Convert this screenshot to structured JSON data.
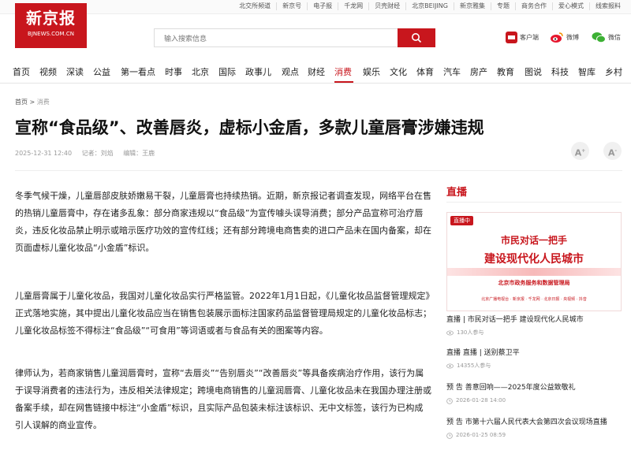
{
  "top_links": [
    "北交所频道",
    "新京号",
    "电子报",
    "千龙网",
    "贝壳财经",
    "北京BEIJING",
    "新京雅集",
    "专题",
    "商务合作",
    "爱心模式",
    "线索报料"
  ],
  "logo": {
    "cn": "新京报",
    "en": "BJNEWS.COM.CN"
  },
  "search": {
    "placeholder": "输入搜索信息"
  },
  "tools": {
    "client": "客户端",
    "weibo": "微博",
    "wechat": "微信"
  },
  "nav": [
    "首页",
    "视频",
    "深读",
    "公益",
    "第一看点",
    "时事",
    "北京",
    "国际",
    "政事儿",
    "观点",
    "财经",
    "消费",
    "娱乐",
    "文化",
    "体育",
    "汽车",
    "房产",
    "教育",
    "图说",
    "科技",
    "智库",
    "乡村"
  ],
  "nav_active": "消费",
  "breadcrumb": {
    "home": "首页",
    "sep": ">",
    "current": "消费"
  },
  "article": {
    "title": "宣称“食品级”、改善唇炎，虚标小金盾，多款儿童唇膏涉嫌违规",
    "date": "2025-12-31 12:40",
    "reporter": "记者：刘焰",
    "editor": "编辑：王鹿",
    "font_up": "A",
    "font_down": "A",
    "paragraphs": [
      "冬季气候干燥，儿童唇部皮肤娇嫩易干裂，儿童唇膏也持续热销。近期，新京报记者调查发现，网络平台在售的热销儿童唇膏中，存在诸多乱象：部分商家违规以“食品级”为宣传噱头误导消费；部分产品宣称可治疗唇炎，违反化妆品禁止明示或暗示医疗功效的宣传红线；还有部分跨境电商售卖的进口产品未在国内备案，却在页面虚标儿童化妆品“小金盾”标识。",
      "儿童唇膏属于儿童化妆品，我国对儿童化妆品实行严格监管。2022年1月1日起，《儿童化妆品监督管理规定》正式落地实施，其中提出儿童化妆品应当在销售包装展示面标注国家药品监督管理局规定的儿童化妆品标志；儿童化妆品标签不得标注“食品级”“可食用”等词语或者与食品有关的图案等内容。",
      "律师认为，若商家销售儿童润唇膏时，宣称“去唇炎”“告别唇炎”“改善唇炎”等具备疾病治疗作用，该行为属于误导消费者的违法行为，违反相关法律规定；跨境电商销售的儿童润唇膏、儿童化妆品未在我国办理注册或备案手续，却在网售链接中标注“小金盾”标识，且实际产品包装未标注该标识、无中文标签，该行为已构成引人误解的商业宣传。"
    ]
  },
  "sidebar": {
    "title": "直播",
    "banner": {
      "tag": "直播中",
      "line1": "市民对话一把手",
      "line2": "建设现代化人民城市",
      "line3": "北京市政务服务和数据管理局",
      "logos": "北京广播电视台 · 新京报 · 千龙网 · 北京日报 · 央视频 · 抖音"
    },
    "items": [
      {
        "title": "直播 | 市民对话一把手 建设现代化人民城市",
        "sub": "130人参与",
        "icon": "eye-icon"
      },
      {
        "title": "直播 直播 | 送别蔡卫平",
        "sub": "14355人参与",
        "icon": "eye-icon"
      },
      {
        "title": "预 告 善意回响——2025年度公益致敬礼",
        "sub": "2026-01-28 14:00",
        "icon": "clock-icon"
      },
      {
        "title": "预 告 市第十六届人民代表大会第四次会议现场直播",
        "sub": "2026-01-25 08:59",
        "icon": "clock-icon"
      }
    ]
  },
  "colors": {
    "brand": "#c8161d"
  }
}
